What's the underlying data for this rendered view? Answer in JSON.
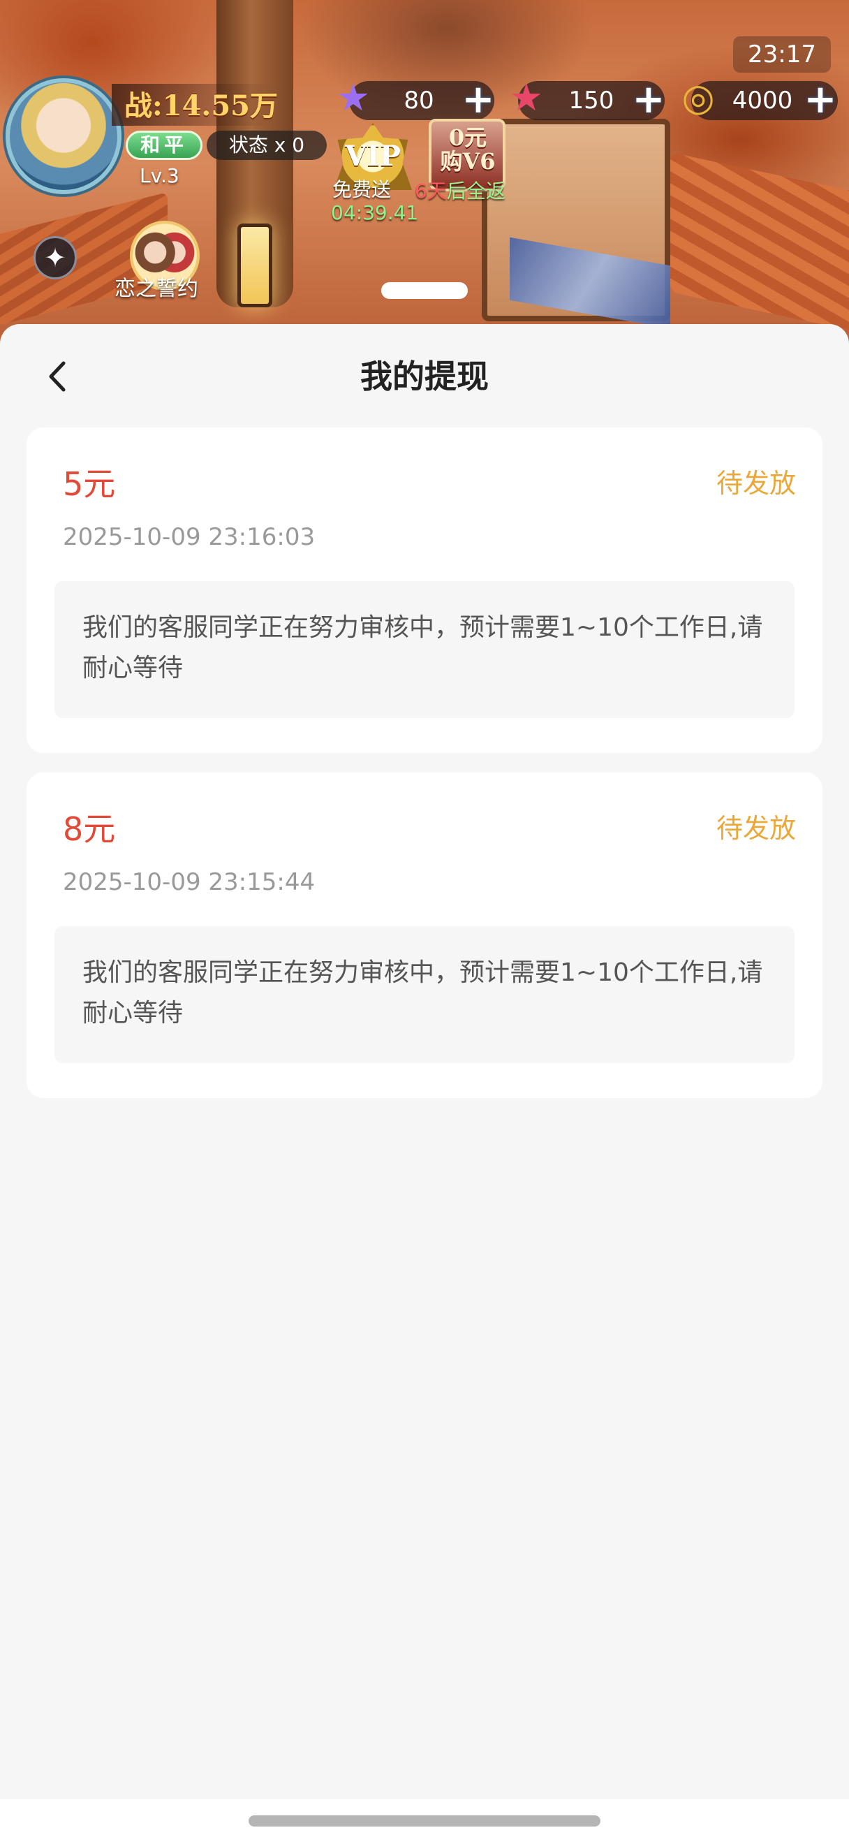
{
  "game_hud": {
    "clock": "23:17",
    "power": "战:14.55万",
    "peace_mode": "和平",
    "status": "状态 x 0",
    "level": "Lv.3",
    "resources": [
      {
        "icon": "purple-star-icon",
        "value": "80"
      },
      {
        "icon": "red-star-icon",
        "value": "150"
      },
      {
        "icon": "gold-coin-icon",
        "value": "4000"
      }
    ],
    "vip_badge": "VIP",
    "buy_badge": "0元购V6",
    "free_gift_label": "免费送",
    "free_gift_timer": "04:39.41",
    "return_days": "6天",
    "return_suffix": "后全返",
    "couple_label": "恋之誓约"
  },
  "page": {
    "title": "我的提现",
    "back_icon": "chevron-left-icon"
  },
  "withdrawals": [
    {
      "amount": "5元",
      "status": "待发放",
      "time": "2025-10-09 23:16:03",
      "note": "我们的客服同学正在努力审核中，预计需要1~10个工作日,请耐心等待"
    },
    {
      "amount": "8元",
      "status": "待发放",
      "time": "2025-10-09 23:15:44",
      "note": "我们的客服同学正在努力审核中，预计需要1~10个工作日,请耐心等待"
    }
  ],
  "colors": {
    "amount": "#e24a38",
    "status_pending": "#e9a93a",
    "sheet_bg": "#f6f6f6",
    "card_bg": "#ffffff"
  }
}
